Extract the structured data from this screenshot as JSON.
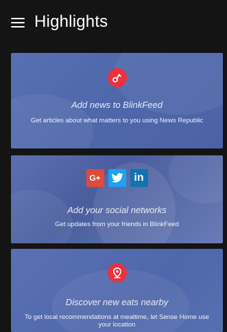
{
  "header": {
    "title": "Highlights",
    "menu_icon": "hamburger-icon"
  },
  "cards": [
    {
      "title": "Add news to BlinkFeed",
      "description": "Get articles about what matters to you using News Republic",
      "icon": "news-republic-icon",
      "accent": "#e9323c"
    },
    {
      "title": "Add your social networks",
      "description": "Get updates from your friends in BlinkFeed",
      "icons": [
        {
          "name": "google-plus-icon",
          "label": "G+",
          "color": "#dd4b39"
        },
        {
          "name": "twitter-icon",
          "label": "",
          "color": "#1da1f2"
        },
        {
          "name": "linkedin-icon",
          "label": "in",
          "color": "#1173b0"
        }
      ]
    },
    {
      "title": "Discover new eats nearby",
      "description": "To get local recommendations at mealtime, let Sense Home use your location",
      "icon": "location-pin-icon",
      "accent": "#e9323c"
    }
  ],
  "colors": {
    "background": "#141414",
    "card": "#5068ab"
  }
}
